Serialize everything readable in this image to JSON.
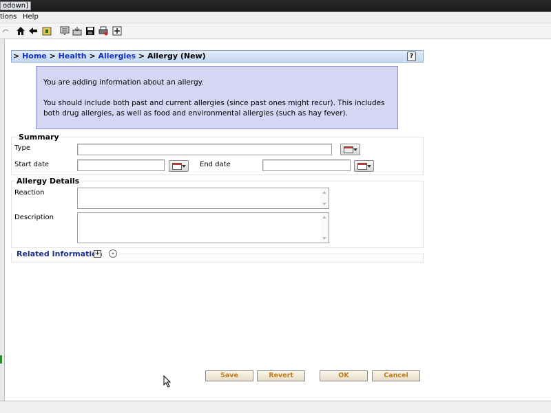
{
  "window": {
    "title": "odown]"
  },
  "menu": {
    "items": [
      "tions",
      "Help"
    ]
  },
  "toolbar": {
    "icons": [
      "home-icon",
      "back-arrow-icon",
      "folder-icon",
      "list-icon",
      "inbox-icon",
      "save-disk-icon",
      "print-icon",
      "add-icon"
    ]
  },
  "breadcrumb": {
    "prefix": ">",
    "home": "Home",
    "sep1": ">",
    "health": "Health",
    "sep2": ">",
    "allergies": "Allergies",
    "sep3": ">",
    "current": "Allergy (New)",
    "help": "?"
  },
  "info": {
    "line1": "You are adding information about an allergy.",
    "line2": "You should include both past and current allergies (since past ones might recur). This includes both drug allergies, as well as food and environmental allergies (such as hay fever)."
  },
  "summary": {
    "title": "Summary",
    "type_label": "Type",
    "type_value": "",
    "start_label": "Start date",
    "start_value": "",
    "end_label": "End date",
    "end_value": ""
  },
  "details": {
    "title": "Allergy Details",
    "reaction_label": "Reaction",
    "reaction_value": "",
    "description_label": "Description",
    "description_value": ""
  },
  "related": {
    "label": "Related Information",
    "plus": "+",
    "expand": "»"
  },
  "buttons": {
    "save": "Save",
    "revert": "Revert",
    "ok": "OK",
    "cancel": "Cancel"
  }
}
